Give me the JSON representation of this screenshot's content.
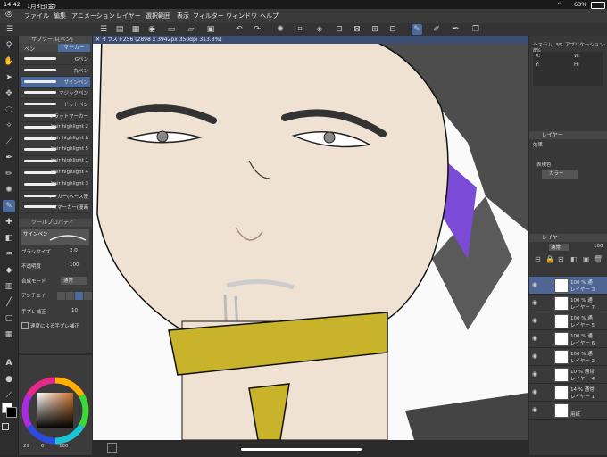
{
  "status": {
    "time": "14:42",
    "date": "1月8日(金)",
    "battery": "63%"
  },
  "menu": [
    "ファイル",
    "編集",
    "アニメーション",
    "レイヤー",
    "選択範囲",
    "表示",
    "フィルター",
    "ウィンドウ",
    "ヘルプ"
  ],
  "subtool": {
    "title": "サブツール[ペン]",
    "tabs": [
      "ペン",
      "マーカー"
    ],
    "brushes": [
      "Gペン",
      "丸ペン",
      "サインペン",
      "マジックペン",
      "ドットペン",
      "フラットマーカー",
      "hair highlight 2",
      "hair highlight 6",
      "hair highlight 5",
      "hair highlight 1",
      "hair highlight 4",
      "hair highlight 3",
      "マーカー(ベース漫",
      "Tマーカー(漫画"
    ]
  },
  "toolprop": {
    "title": "ツールプロパティ",
    "brush_name": "サインペン",
    "brush_size_label": "ブラシサイズ",
    "brush_size": "2.0",
    "opacity_label": "不透明度",
    "opacity": "100",
    "blend_label": "合成モード",
    "blend": "通常",
    "aa_label": "アンチエイ",
    "stab_label": "手ブレ補正",
    "stab": "10",
    "speed_label": "速度による手ブレ補正"
  },
  "canvas": {
    "title": "イラスト256 (2898 x 3942px 350dpi 313.3%)"
  },
  "footer": {
    "val1": "29",
    "val2": "0",
    "val3": "180"
  },
  "right": {
    "navigator_labels": {
      "system": "システム: 3%",
      "app": "アプリケーション: 8%",
      "x": "X:",
      "y": "Y:",
      "w": "W:",
      "h": "H:"
    },
    "effect_title": "効果",
    "expression_label": "表現色",
    "expression_value": "カラー",
    "layer_title": "レイヤー",
    "blend_mode": "通常",
    "opacity": "100",
    "layers": [
      {
        "op": "100 % 通",
        "name": "レイヤー 3",
        "sel": true
      },
      {
        "op": "100 % 通",
        "name": "レイヤー 7",
        "sel": false
      },
      {
        "op": "100 % 通",
        "name": "レイヤー 5",
        "sel": false
      },
      {
        "op": "100 % 通",
        "name": "レイヤー 6",
        "sel": false
      },
      {
        "op": "100 % 通",
        "name": "レイヤー 2",
        "sel": false
      },
      {
        "op": "10 % 通常",
        "name": "レイヤー 4",
        "sel": false
      },
      {
        "op": "14 % 通常",
        "name": "レイヤー 1",
        "sel": false
      },
      {
        "op": "",
        "name": "用紙",
        "sel": false
      }
    ]
  },
  "colors": {
    "accent": "#4c6a9c",
    "collar": "#c9b32a",
    "skin": "#efe2d2",
    "hair": "#4a4a4a",
    "purple": "#7b4ad6"
  }
}
